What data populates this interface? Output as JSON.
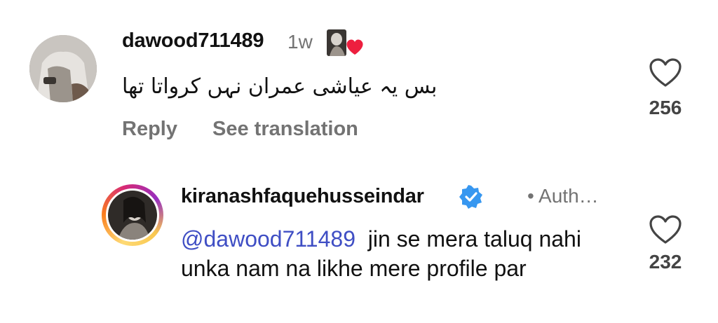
{
  "comment": {
    "username": "dawood711489",
    "time": "1w",
    "text": "بس یہ عیاشی عمران نہں کرواتا تھا",
    "reply_label": "Reply",
    "translate_label": "See translation",
    "like_count": "256",
    "sticker_icon": "photo-heart-sticker-icon"
  },
  "reply": {
    "username": "kiranashfaquehusseindar",
    "verified_icon": "verified-badge-icon",
    "author_label": "• Auth…",
    "mention": "@dawood711489",
    "text": "  jin se mera taluq nahi unka nam na likhe mere profile par",
    "like_count": "232"
  },
  "colors": {
    "mention": "#3f4ec4",
    "secondary_text": "#737373",
    "verified": "#3797f0"
  }
}
